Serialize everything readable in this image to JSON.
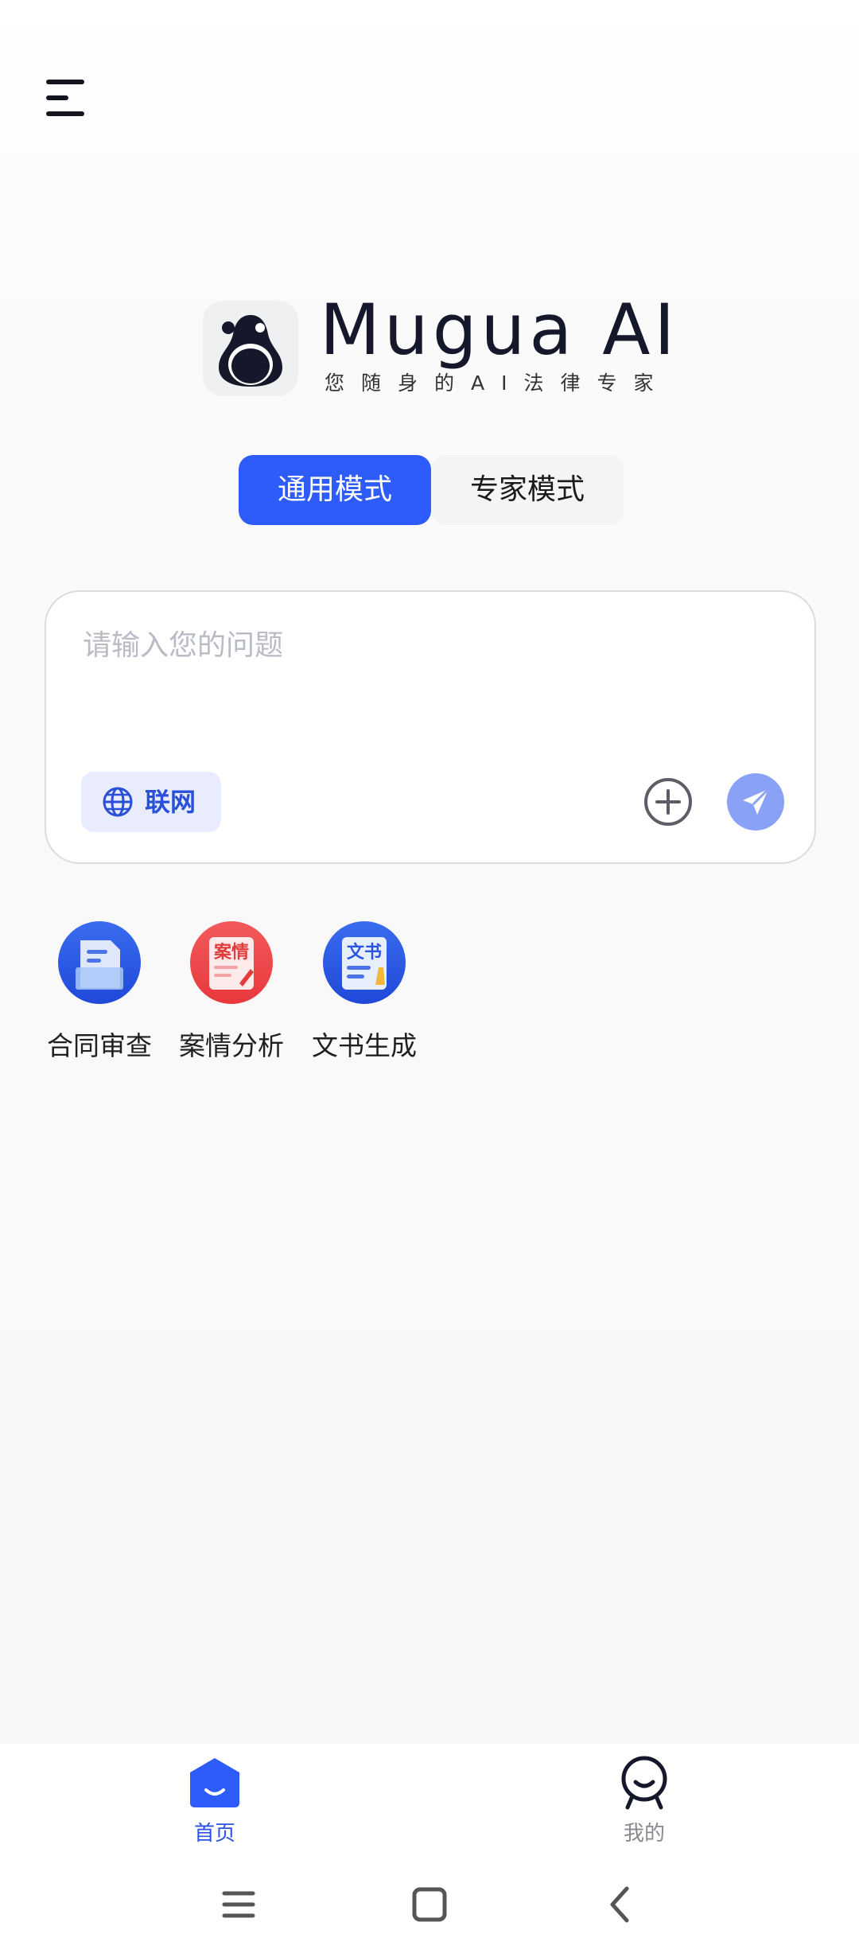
{
  "header": {
    "menu_icon": "hamburger-menu-icon"
  },
  "brand": {
    "logo_icon": "avocado-logo-icon",
    "name": "Mugua AI",
    "tagline": "您随身的AI法律专家"
  },
  "mode_tabs": [
    {
      "label": "通用模式",
      "active": true
    },
    {
      "label": "专家模式",
      "active": false
    }
  ],
  "input": {
    "placeholder": "请输入您的问题",
    "value": "",
    "web_label": "联网",
    "web_icon": "globe-icon",
    "add_icon": "plus-circle-icon",
    "send_icon": "paper-plane-icon"
  },
  "tools": [
    {
      "label": "合同审查",
      "icon": "contract-review-icon"
    },
    {
      "label": "案情分析",
      "icon": "case-analysis-icon",
      "icon_text": "案情"
    },
    {
      "label": "文书生成",
      "icon": "document-generate-icon",
      "icon_text": "文书"
    }
  ],
  "bottom_nav": [
    {
      "label": "首页",
      "icon": "home-icon",
      "active": true
    },
    {
      "label": "我的",
      "icon": "profile-icon",
      "active": false
    }
  ],
  "system_nav": {
    "recents_icon": "recents-icon",
    "home_icon": "square-home-icon",
    "back_icon": "back-chevron-icon"
  },
  "colors": {
    "accent": "#2e5cfa",
    "accent_light": "#e8ecfc",
    "send_button": "#8aa2f6",
    "text_dark": "#15182a",
    "placeholder": "#b9bcc4"
  }
}
